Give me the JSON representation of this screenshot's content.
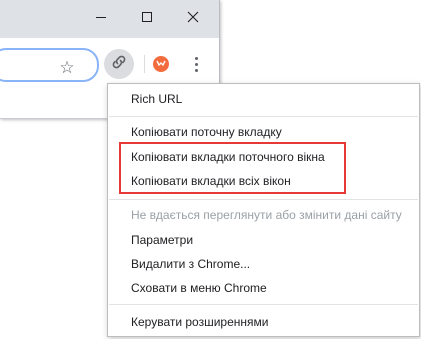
{
  "window_controls": {
    "minimize_icon": "minimize-icon",
    "maximize_icon": "maximize-icon",
    "close_icon": "close-icon"
  },
  "toolbar": {
    "bookmark_icon": "star-icon",
    "active_extension_icon": "link-icon",
    "extension_icon": "fox-icon",
    "menu_icon": "kebab-menu-icon"
  },
  "menu": {
    "title": "Rich URL",
    "items_group1": [
      "Копіювати поточну вкладку",
      "Копіювати вкладки поточного вікна",
      "Копіювати вкладки всіх вікон"
    ],
    "site_access_label": "Не вдається переглянути або змінити дані сайту",
    "items_group2": [
      "Параметри",
      "Видалити з Chrome...",
      "Сховати в меню Chrome"
    ],
    "manage_extensions": "Керувати розширеннями"
  },
  "colors": {
    "highlight": "#e53935",
    "window_frame": "#dee1e6",
    "focus_ring": "#8ab4f8",
    "extension_accent": "#f26c3e"
  }
}
